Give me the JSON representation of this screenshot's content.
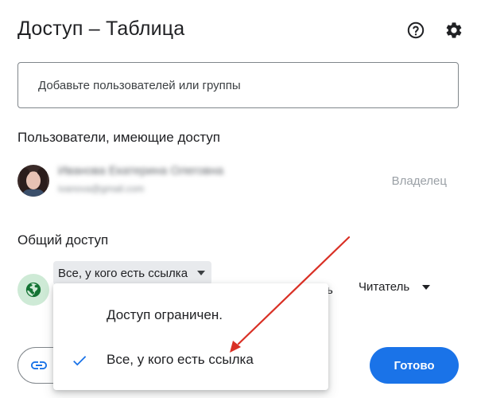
{
  "dialog": {
    "title": "Доступ – Таблица"
  },
  "header": {
    "help_icon": "help-circle-icon",
    "settings_icon": "gear-icon"
  },
  "add_people": {
    "placeholder": "Добавьте пользователей или группы"
  },
  "people_section": {
    "title": "Пользователи, имеющие доступ",
    "users": [
      {
        "name": "Иванова Екатерина Олеговна",
        "email": "ivanova@gmail.com",
        "role": "Владелец"
      }
    ]
  },
  "general_access": {
    "title": "Общий доступ",
    "selected": "Все, у кого есть ссылка",
    "hidden_tail": "ь",
    "role": "Читатель",
    "icon": "globe-icon"
  },
  "access_menu": {
    "options": [
      {
        "label": "Доступ ограничен.",
        "selected": false
      },
      {
        "label": "Все, у кого есть ссылка",
        "selected": true
      }
    ]
  },
  "footer": {
    "copy_link_icon": "link-icon",
    "done_label": "Готово"
  },
  "colors": {
    "accent": "#1a73e8",
    "annotation": "#d93025",
    "globe_bg": "#ceead6"
  }
}
